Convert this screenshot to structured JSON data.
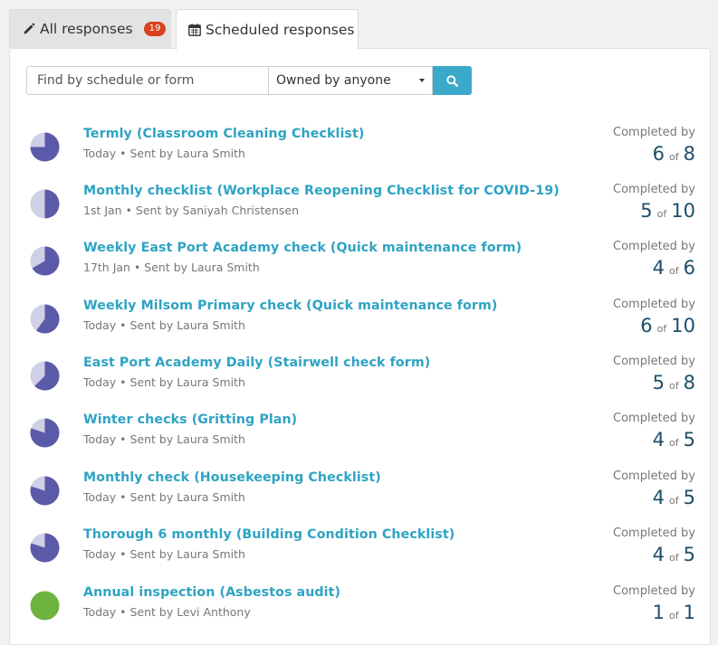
{
  "tabs": {
    "all": {
      "label": "All responses",
      "count": "19"
    },
    "scheduled": {
      "label": "Scheduled responses"
    }
  },
  "search": {
    "placeholder": "Find by schedule or form",
    "value": ""
  },
  "owner_filter": {
    "selected": "Owned by anyone"
  },
  "completed_label": "Completed by",
  "of_label": "of",
  "colors": {
    "accent": "#3ba9c9",
    "link": "#2ea3c3",
    "pie_fill": "#5b5aa8",
    "pie_bg": "#cfcfe6",
    "complete": "#6db33f",
    "badge": "#d9401e"
  },
  "responses": [
    {
      "title": "Termly (Classroom Cleaning Checklist)",
      "meta": "Today • Sent by Laura Smith",
      "done": "6",
      "total": "8"
    },
    {
      "title": "Monthly checklist (Workplace Reopening Checklist for COVID-19)",
      "meta": "1st Jan • Sent by Saniyah Christensen",
      "done": "5",
      "total": "10"
    },
    {
      "title": "Weekly East Port Academy check (Quick maintenance form)",
      "meta": "17th Jan • Sent by Laura Smith",
      "done": "4",
      "total": "6"
    },
    {
      "title": "Weekly Milsom Primary check (Quick maintenance form)",
      "meta": "Today • Sent by Laura Smith",
      "done": "6",
      "total": "10"
    },
    {
      "title": "East Port Academy Daily (Stairwell check form)",
      "meta": "Today • Sent by Laura Smith",
      "done": "5",
      "total": "8"
    },
    {
      "title": "Winter checks (Gritting Plan)",
      "meta": "Today • Sent by Laura Smith",
      "done": "4",
      "total": "5"
    },
    {
      "title": "Monthly check (Housekeeping Checklist)",
      "meta": "Today • Sent by Laura Smith",
      "done": "4",
      "total": "5"
    },
    {
      "title": "Thorough 6 monthly (Building Condition Checklist)",
      "meta": "Today • Sent by Laura Smith",
      "done": "4",
      "total": "5"
    },
    {
      "title": "Annual inspection (Asbestos audit)",
      "meta": "Today • Sent by Levi Anthony",
      "done": "1",
      "total": "1"
    }
  ]
}
